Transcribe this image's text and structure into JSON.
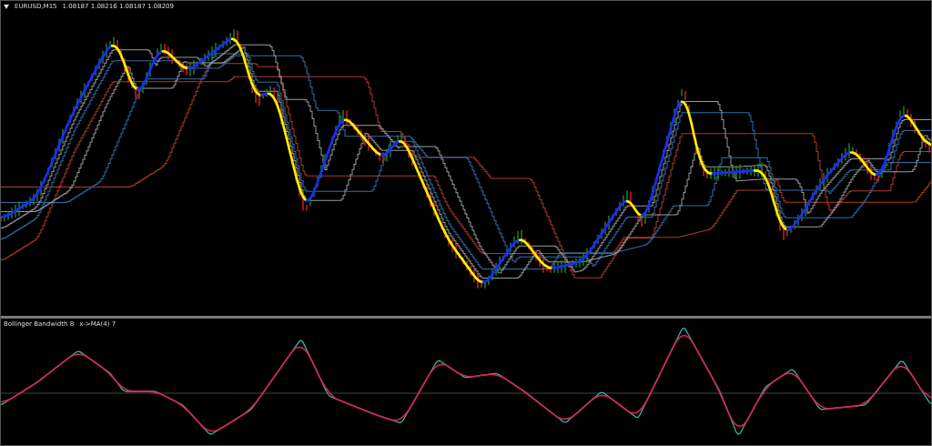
{
  "main_chart": {
    "collapsed": false,
    "symbol": "EURUSD,M15",
    "quotes": "1.08187 1.08216 1.08187 1.08209"
  },
  "indicator_window": {
    "title": "Bollinger Bandwidth 8",
    "signal": "x->MA(4) 7"
  }
}
